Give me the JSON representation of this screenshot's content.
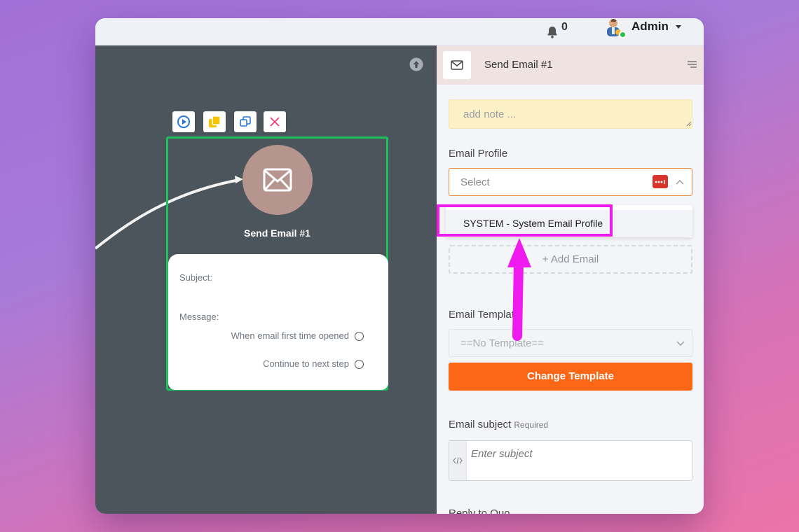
{
  "topbar": {
    "notification_count": "0",
    "user_name": "Admin"
  },
  "node": {
    "title": "Send Email #1",
    "subject_label": "Subject:",
    "message_label": "Message:",
    "options": [
      "When email first time opened",
      "Continue to next step"
    ]
  },
  "panel": {
    "title": "Send Email #1",
    "note_placeholder": "add note ...",
    "email_profile_label": "Email Profile",
    "profile_select_value": "Select",
    "dropdown_option": "SYSTEM - System Email Profile",
    "add_email_label": "+ Add Email",
    "email_template_label": "Email Template",
    "template_value": "==No Template==",
    "change_template_label": "Change Template",
    "email_subject_label": "Email subject",
    "required_label": "Required",
    "subject_placeholder": "Enter subject",
    "cut_label": "Reply to Quo"
  },
  "colors": {
    "accent_orange": "#fc6617",
    "highlight_magenta": "#ee1aee",
    "node_border": "#19c25a"
  }
}
